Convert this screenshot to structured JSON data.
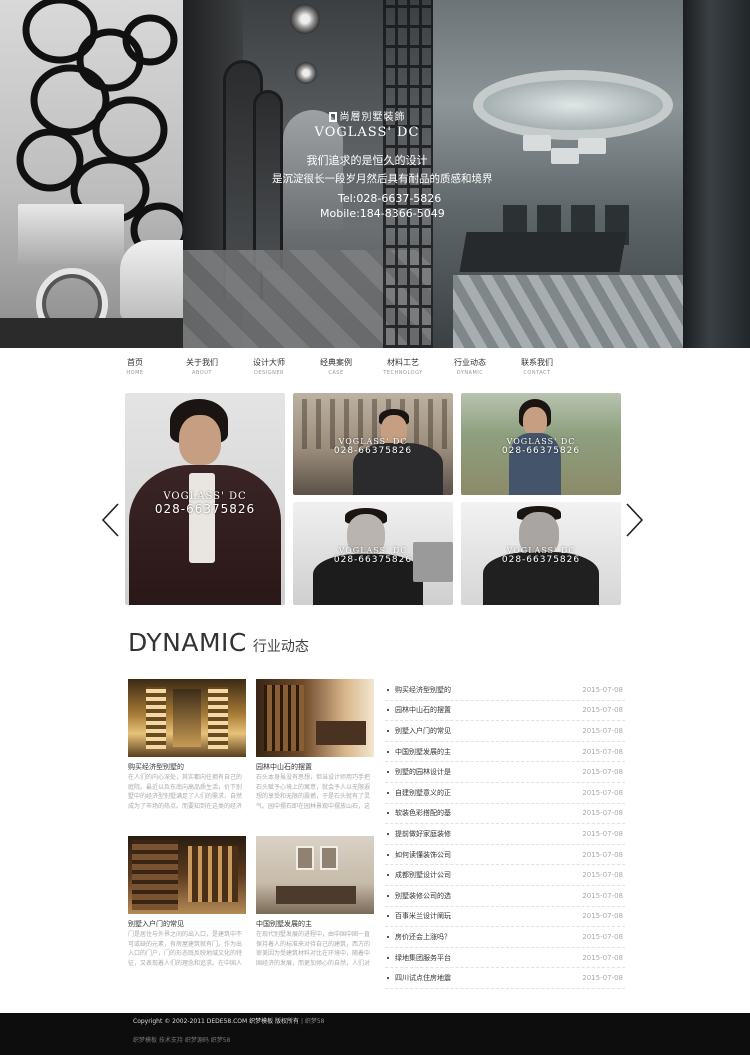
{
  "banner": {
    "logo_mark": "尚層別墅裝飾",
    "logo_text": "VOGLASS' DC",
    "tagline_line1": "我们追求的是恒久的设计",
    "tagline_line2": "是沉淀很长一段岁月然后具有耐品的质感和境界",
    "tel": "Tel:028-6637-5826",
    "mobile": "Mobile:184-8366-5049"
  },
  "nav": {
    "items": [
      {
        "cn": "首页",
        "en": "HOME"
      },
      {
        "cn": "关于我们",
        "en": "ABOUT"
      },
      {
        "cn": "设计大师",
        "en": "DESIGNER"
      },
      {
        "cn": "经典案例",
        "en": "CASE"
      },
      {
        "cn": "材料工艺",
        "en": "TECHNOLOGY"
      },
      {
        "cn": "行业动态",
        "en": "DYNAMIC"
      },
      {
        "cn": "联系我们",
        "en": "CONTACT"
      }
    ]
  },
  "gallery": {
    "watermark_logo": "VOGLASS' DC",
    "watermark_logo_small": "尚層別墅裝飾",
    "watermark_tel": "028-66375826"
  },
  "section": {
    "title_en": "DYNAMIC",
    "title_cn": "行业动态"
  },
  "cards": [
    {
      "title": "购买经济型别墅的",
      "desc": "在人们的内心深处，其实都向往拥有自己的庭院。最近以及东南向高品质生活，价下别墅中的经济型别墅满足了人们的需求，自然成为了市场的热点。而要知到在这类的经济型别墅中找..."
    },
    {
      "title": "园林中山石的摆置",
      "desc": "石头本身虽没有思想，但当设计师用巧手把石头赋予心境上的寓意，就会予人以无限遐想的享受和无限的震撼，于是石头就有了灵气。园中摆石即在园林景观中摆放山石，这是一种文化..."
    },
    {
      "title": "别墅入户门的常见",
      "desc": "门是居住与外界之间的出入口，是建筑中不可或缺的元素，有房屋建筑就有门。作为出入口的门户，门的形态既反映地域文化的特征，又表现着人们的理念和追求。在中国人的传统观念..."
    },
    {
      "title": "中国别墅发展的主",
      "desc": "在现代别墅发展的进程中，由中国中国一直保持着人的标准来对待自己的建筑，西方的审美因为受建筑材料对比在环境中，随着中国经济的发展，而更加倾心的自然，人们对中国文化..."
    }
  ],
  "news": [
    {
      "title": "购买经济型别墅的",
      "date": "2015-07-08"
    },
    {
      "title": "园林中山石的摆置",
      "date": "2015-07-08"
    },
    {
      "title": "别墅入户门的常见",
      "date": "2015-07-08"
    },
    {
      "title": "中国别墅发展的主",
      "date": "2015-07-08"
    },
    {
      "title": "别墅的园林设计是",
      "date": "2015-07-08"
    },
    {
      "title": "自建别墅意义的正",
      "date": "2015-07-08"
    },
    {
      "title": "软装色彩搭配的基",
      "date": "2015-07-08"
    },
    {
      "title": "提前做好家庭装修",
      "date": "2015-07-08"
    },
    {
      "title": "如何读懂装饰公司",
      "date": "2015-07-08"
    },
    {
      "title": "成都别墅设计公司",
      "date": "2015-07-08"
    },
    {
      "title": "别墅装修公司的选",
      "date": "2015-07-08"
    },
    {
      "title": "百事米兰设计阐玩",
      "date": "2015-07-08"
    },
    {
      "title": "房价还会上涨吗？",
      "date": "2015-07-08"
    },
    {
      "title": "绿地集团服务平台",
      "date": "2015-07-08"
    },
    {
      "title": "四川试点住房地震",
      "date": "2015-07-08"
    }
  ],
  "footer": {
    "copyright": "Copyright © 2002-2011 DEDE58.COM 织梦模板 版权所有",
    "copyright_extra": "| 织梦58",
    "links": "织梦模板 技术支持 织梦源码 织梦58"
  },
  "colors": {
    "footer_bg": "#0d0d0d",
    "accent_text": "#333333",
    "muted_text": "#aaaaaa"
  }
}
